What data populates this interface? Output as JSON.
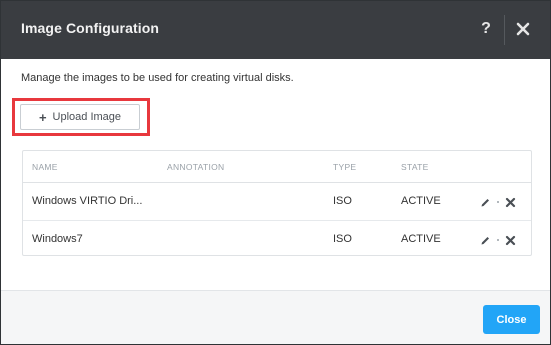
{
  "dialog": {
    "title": "Image Configuration",
    "help_label": "?",
    "description": "Manage the images to be used for creating virtual disks."
  },
  "upload_button": {
    "icon": "plus-icon",
    "label": "Upload Image"
  },
  "table": {
    "headers": {
      "name": "NAME",
      "annotation": "ANNOTATION",
      "type": "TYPE",
      "state": "STATE"
    },
    "rows": [
      {
        "name": "Windows VIRTIO Dri...",
        "annotation": "",
        "type": "ISO",
        "state": "ACTIVE"
      },
      {
        "name": "Windows7",
        "annotation": "",
        "type": "ISO",
        "state": "ACTIVE"
      }
    ]
  },
  "footer": {
    "close_label": "Close"
  },
  "colors": {
    "header_bg": "#3a3d41",
    "primary": "#22a5f7",
    "highlight": "#e8383d"
  }
}
